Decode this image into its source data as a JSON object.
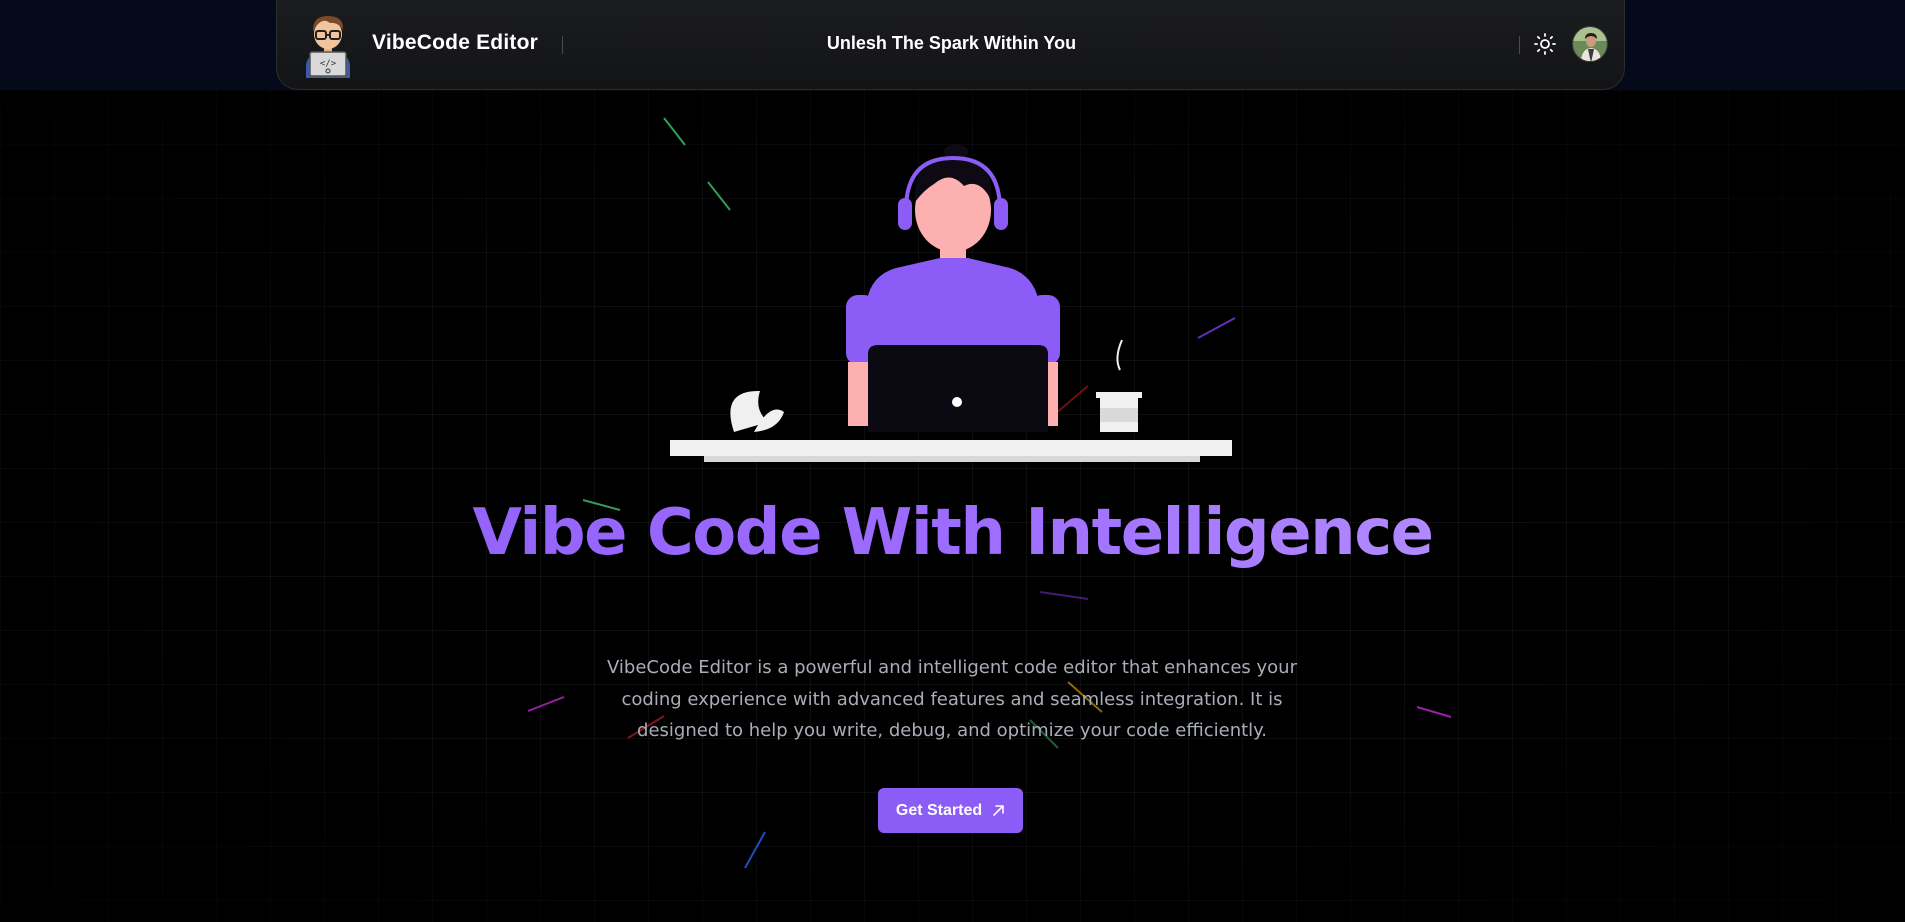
{
  "navbar": {
    "brand": "VibeCode Editor",
    "tagline": "Unlesh The Spark Within You",
    "theme_icon": "sun-icon",
    "avatar_icon": "user-avatar"
  },
  "hero": {
    "illustration": "developer-with-headphones-at-laptop",
    "headline": "Vibe Code With Intelligence",
    "description_lines": [
      "VibeCode Editor is a powerful and intelligent code editor that enhances your",
      "coding experience with advanced features and seamless integration. It is",
      "designed to help you write, debug, and optimize your code efficiently."
    ],
    "cta_label": "Get Started",
    "cta_icon": "arrow-up-right-icon"
  },
  "colors": {
    "accent": "#8b5cf6",
    "accent_light": "#c4a8ff",
    "background": "#000000",
    "navbar_bg": "#1b1c1f",
    "text_muted": "#a9adb8"
  }
}
